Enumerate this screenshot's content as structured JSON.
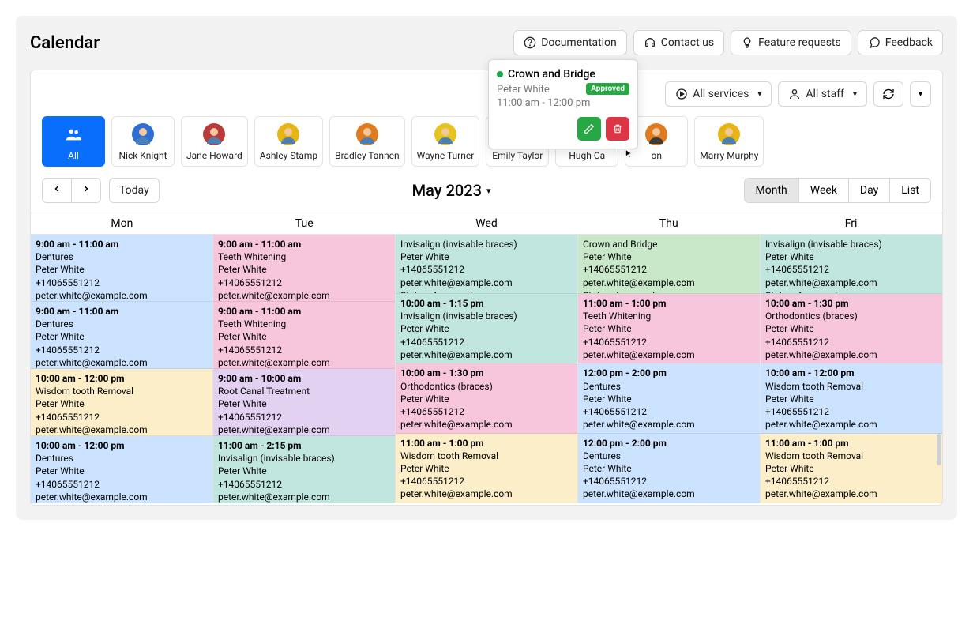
{
  "title": "Calendar",
  "header_buttons": {
    "doc": "Documentation",
    "contact": "Contact us",
    "feature": "Feature requests",
    "feedback": "Feedback"
  },
  "toolbar": {
    "services": "All services",
    "staff": "All staff"
  },
  "staff": [
    {
      "label": "All",
      "sel": true,
      "bg": "#fff",
      "fg": "#fff"
    },
    {
      "label": "Nick Knight",
      "bg": "#2f6fd3"
    },
    {
      "label": "Jane Howard",
      "bg": "#b93a3a"
    },
    {
      "label": "Ashley Stamp",
      "bg": "#e7b515"
    },
    {
      "label": "Bradley Tannen",
      "bg": "#e07b1f"
    },
    {
      "label": "Wayne Turner",
      "bg": "#e7c31f"
    },
    {
      "label": "Emily Taylor",
      "bg": "#3b3b3b"
    },
    {
      "label": "Hugh Ca",
      "bg": "#e07b1f",
      "cut": true
    },
    {
      "label": "on",
      "bg": "#e07b1f",
      "cut": true,
      "bg2": "#3b3b3b"
    },
    {
      "label": "Marry Murphy",
      "bg": "#e7b515"
    }
  ],
  "nav": {
    "today": "Today",
    "month": "May 2023"
  },
  "views": {
    "month": "Month",
    "week": "Week",
    "day": "Day",
    "list": "List"
  },
  "dayheads": [
    "Mon",
    "Tue",
    "Wed",
    "Thu",
    "Fri"
  ],
  "popover": {
    "title": "Crown and Bridge",
    "who": "Peter White",
    "time": "11:00 am - 12:00 pm",
    "badge": "Approved"
  },
  "p": {
    "name": "Peter White",
    "phone": "+14065551212",
    "email": "peter.white@example.com",
    "status": "Status: Approved"
  },
  "cal": {
    "mon": [
      {
        "t": "9:00 am - 11:00 am",
        "s": "Dentures",
        "c": "c-blue"
      },
      {
        "t": "9:00 am - 11:00 am",
        "s": "Dentures",
        "c": "c-blue"
      },
      {
        "t": "10:00 am - 12:00 pm",
        "s": "Wisdom tooth Removal",
        "c": "c-yellow"
      },
      {
        "t": "10:00 am - 12:00 pm",
        "s": "Dentures",
        "c": "c-blue"
      }
    ],
    "tue": [
      {
        "t": "9:00 am - 11:00 am",
        "s": "Teeth Whitening",
        "c": "c-pink"
      },
      {
        "t": "9:00 am - 11:00 am",
        "s": "Teeth Whitening",
        "c": "c-pink"
      },
      {
        "t": "9:00 am - 10:00 am",
        "s": "Root Canal Treatment",
        "c": "c-purple"
      },
      {
        "t": "11:00 am - 2:15 pm",
        "s": "Invisalign (invisable braces)",
        "c": "c-teal"
      }
    ],
    "wed": [
      {
        "t": "",
        "s": "Invisalign (invisable braces)",
        "c": "c-teal",
        "short": true
      },
      {
        "t": "10:00 am - 1:15 pm",
        "s": "Invisalign (invisable braces)",
        "c": "c-teal"
      },
      {
        "t": "10:00 am - 1:30 pm",
        "s": "Orthodontics (braces)",
        "c": "c-pink"
      },
      {
        "t": "11:00 am - 1:00 pm",
        "s": "Wisdom tooth Removal",
        "c": "c-yellow"
      }
    ],
    "thu": [
      {
        "t": "",
        "s": "Crown and Bridge",
        "c": "c-green",
        "short": true
      },
      {
        "t": "11:00 am - 1:00 pm",
        "s": "Teeth Whitening",
        "c": "c-pink"
      },
      {
        "t": "12:00 pm - 2:00 pm",
        "s": "Dentures",
        "c": "c-blue"
      },
      {
        "t": "12:00 pm - 2:00 pm",
        "s": "Dentures",
        "c": "c-blue"
      }
    ],
    "fri": [
      {
        "t": "",
        "s": "Invisalign (invisable braces)",
        "c": "c-teal",
        "short": true
      },
      {
        "t": "10:00 am - 1:30 pm",
        "s": "Orthodontics (braces)",
        "c": "c-pink"
      },
      {
        "t": "10:00 am - 12:00 pm",
        "s": "Wisdom tooth Removal",
        "c": "c-blue"
      },
      {
        "t": "11:00 am - 1:00 pm",
        "s": "Wisdom tooth Removal",
        "c": "c-yellow"
      }
    ]
  }
}
